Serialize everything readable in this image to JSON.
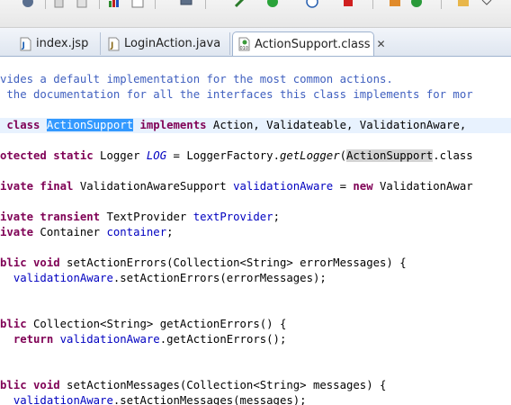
{
  "tabs": [
    {
      "label": "index.jsp",
      "type": "jsp"
    },
    {
      "label": "LoginAction.java",
      "type": "java"
    },
    {
      "label": "ActionSupport.class",
      "type": "class",
      "close": "✕"
    }
  ],
  "code": {
    "comment_1": "vides a default implementation for the most common actions.",
    "comment_2": " the documentation for all the interfaces this class implements for mor",
    "decl_kw": " class ",
    "class_name": "ActionSupport",
    "implements_kw": "implements",
    "interfaces": " Action, Validateable, ValidationAware,",
    "log_kw1": "otected static",
    "log_type": " Logger ",
    "log_field": "LOG",
    "log_eq": " = LoggerFactory.",
    "log_method": "getLogger",
    "log_paren": "(",
    "log_arg": "ActionSupport",
    "log_tail": ".class",
    "va_kw": "ivate final",
    "va_type": " ValidationAwareSupport ",
    "va_field": "validationAware",
    "va_eq": " = ",
    "va_new": "new",
    "va_tail": " ValidationAwar",
    "tp_kw": "ivate transient",
    "tp_type": " TextProvider ",
    "tp_field": "textProvider",
    "tp_semi": ";",
    "ct_kw": "ivate",
    "ct_type": " Container ",
    "ct_field": "container",
    "ct_semi": ";",
    "sae_kw1": "blic void",
    "sae_sig": " setActionErrors(Collection<String> errorMessages) {",
    "sae_field": "validationAware",
    "sae_body": ".setActionErrors(errorMessages);",
    "gae_kw": "blic",
    "gae_sig": " Collection<String> getActionErrors() {",
    "gae_ret": "return",
    "gae_field": "validationAware",
    "gae_body": ".getActionErrors();",
    "sam_kw1": "blic void",
    "sam_sig": " setActionMessages(Collection<String> messages) {",
    "sam_field": "validationAware",
    "sam_body": ".setActionMessages(messages);"
  }
}
